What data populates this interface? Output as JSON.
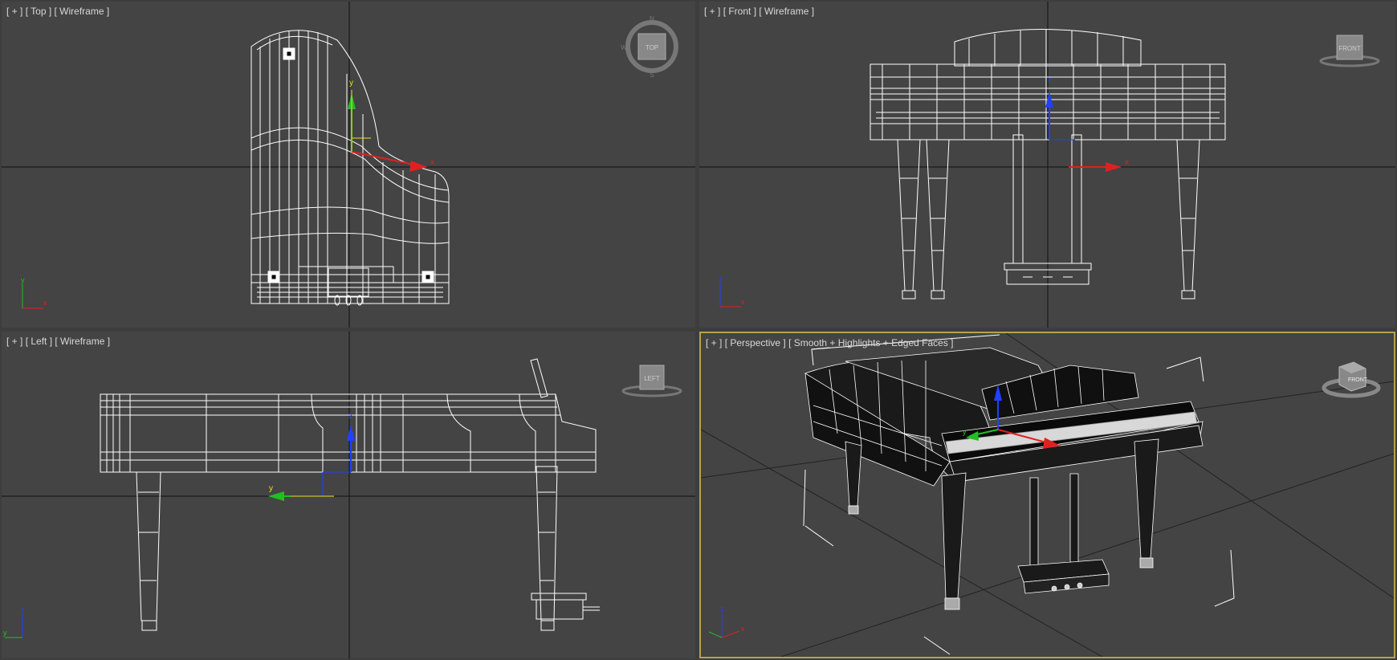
{
  "viewports": {
    "top": {
      "menu": "[ + ]",
      "view": "[ Top ]",
      "shading": "[ Wireframe ]"
    },
    "front": {
      "menu": "[ + ]",
      "view": "[ Front ]",
      "shading": "[ Wireframe ]"
    },
    "left": {
      "menu": "[ + ]",
      "view": "[ Left ]",
      "shading": "[ Wireframe ]"
    },
    "perspective": {
      "menu": "[ + ]",
      "view": "[ Perspective ]",
      "shading": "[ Smooth + Highlights + Edged Faces ]"
    }
  },
  "viewcube": {
    "top": "TOP",
    "front": "FRONT",
    "left": "LEFT",
    "persp": "FRONT",
    "compass_n": "N",
    "compass_w": "W",
    "compass_s": "S"
  },
  "gizmo_axes": {
    "x": "x",
    "y": "y",
    "z": "z"
  },
  "colors": {
    "active_border": "#b5a34a",
    "viewport_bg": "#444444",
    "wire": "#ffffff",
    "axis_x": "#e02020",
    "axis_y": "#20c020",
    "axis_z": "#2040ff",
    "gizmo_yellow": "#e8e020"
  }
}
